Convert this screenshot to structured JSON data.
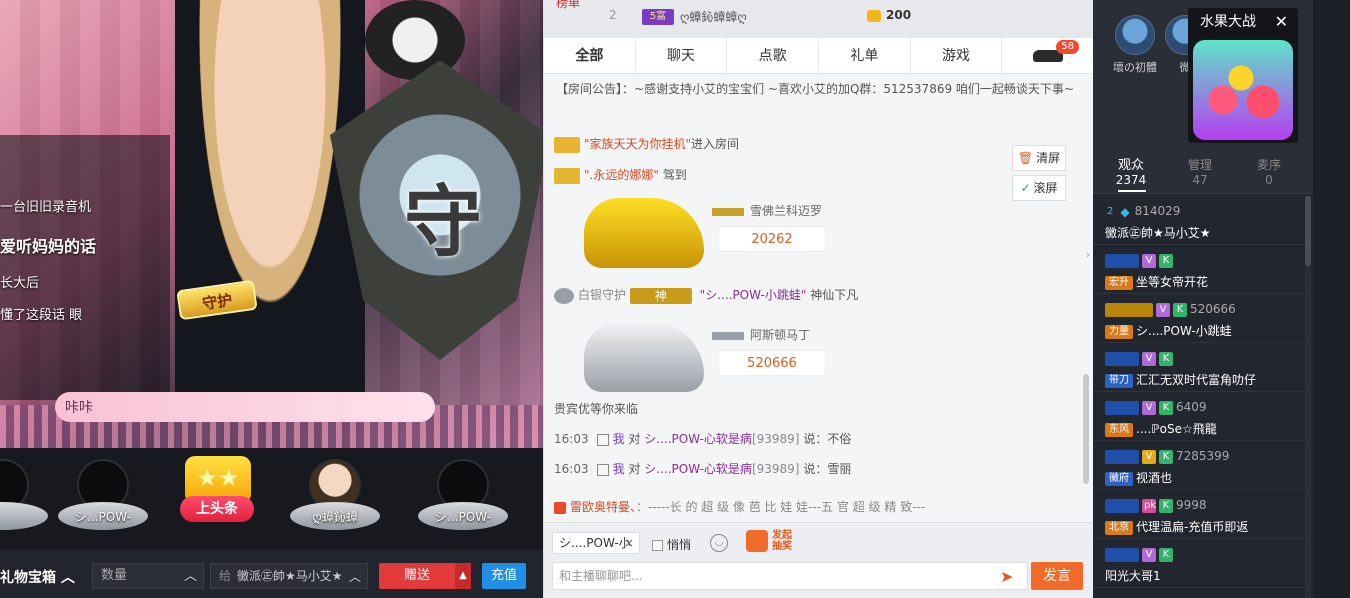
{
  "video": {
    "overlay_lines": [
      "一台旧旧录音机",
      "爱听妈妈的话",
      "长大后",
      "懂了这段话 眼"
    ],
    "shield_char": "守",
    "gold_badge": "守护",
    "nameplate": "咔咔"
  },
  "guards": [
    {
      "name": "シ...POW-",
      "type": "dark"
    },
    {
      "name": "シ...POW-",
      "type": "dark"
    },
    {
      "name": "ღ蟑鈊蟑",
      "type": "light"
    },
    {
      "name": "シ...POW-",
      "type": "dark"
    }
  ],
  "headline": {
    "icon": "★★",
    "label": "上头条"
  },
  "bottombar": {
    "treasure_label": "礼物宝箱",
    "quantity_placeholder": "数量",
    "give_to_label": "给",
    "give_to_value": "黴派㊣帥★马小艾★",
    "send_gift": "赠送",
    "recharge": "充值"
  },
  "chat": {
    "rank": {
      "rank_no": "2",
      "level": "5富",
      "user": "ღ蟑鈊蟑蟑ღ",
      "coins": "200",
      "top_label": "榜单"
    },
    "tabs": [
      {
        "label": "全部",
        "active": true
      },
      {
        "label": "聊天",
        "active": false
      },
      {
        "label": "点歌",
        "active": false
      },
      {
        "label": "礼单",
        "active": false
      },
      {
        "label": "游戏",
        "active": false
      },
      {
        "label": "",
        "count": "58",
        "active": false
      }
    ],
    "announcement_label": "【房间公告】：",
    "announcement_text": "~感谢支持小艾的宝宝们 ~喜欢小艾的加Q群：512537869 咱们一起畅谈天下事~",
    "enter1": {
      "user": "\"家族天天为你挂机\"",
      "action": "进入房间"
    },
    "enter2": {
      "user": "\".永远的娜娜\"",
      "action": "驾到"
    },
    "car1": {
      "brand": "雪佛兰科迈罗",
      "price": "20262"
    },
    "guard_line": {
      "tier": "白银守护",
      "badge": "神",
      "user": "\"シ....POW-小跳蛙\"",
      "action": "神仙下凡"
    },
    "car2": {
      "brand": "阿斯顿马丁",
      "price": "520666"
    },
    "cut_line": "贵宾优等你来临",
    "msgs": [
      {
        "time": "16:03",
        "me": "我",
        "to": "对",
        "target": "シ....POW-心软是病",
        "id": "[93989]",
        "say": "说：不俗"
      },
      {
        "time": "16:03",
        "me": "我",
        "to": "对",
        "target": "シ....POW-心软是病",
        "id": "[93989]",
        "say": "说：雪丽"
      }
    ],
    "system": {
      "name": "雷欧奥特曼、",
      "text": "：-----长 的 超 级 像 芭 比 娃 娃---五 官 超 级 精 致---"
    },
    "tools": {
      "clear": "清屏",
      "scroll": "滚屏"
    },
    "input": {
      "target": "シ....POW-小",
      "whisper": "悄悄",
      "lottery": "发起抽奖",
      "placeholder": "和主播聊聊吧...",
      "send": "发言"
    }
  },
  "right": {
    "top_users": [
      {
        "name": "壞の初體"
      },
      {
        "name": "微"
      }
    ],
    "fruit_game": {
      "title": "水果大战",
      "icon": "fruit-game-icon"
    },
    "tabs": [
      {
        "label": "观众",
        "count": "2374",
        "active": true
      },
      {
        "label": "管理",
        "count": "47",
        "active": false
      },
      {
        "label": "麦序",
        "count": "0",
        "active": false
      }
    ],
    "audience": [
      {
        "badges": [
          "2",
          "diamond"
        ],
        "id": "814029",
        "name": "黴派㊣帥★马小艾★",
        "family": ""
      },
      {
        "badges": [
          "lvl",
          "V",
          "K"
        ],
        "id": "",
        "name": "坐等女帝开花",
        "family": "宏升"
      },
      {
        "badges": [
          "gold",
          "V",
          "K"
        ],
        "id": "520666",
        "name": "シ....POW-小跳蛙",
        "family": "力量"
      },
      {
        "badges": [
          "lvl",
          "V",
          "K"
        ],
        "id": "",
        "name": "汇汇无双时代富角叻仔",
        "family": "带刀"
      },
      {
        "badges": [
          "lvl",
          "V",
          "K"
        ],
        "id": "6409",
        "name": "....ℙoSe☆飛龍",
        "family": "东风"
      },
      {
        "badges": [
          "lvl",
          "V",
          "K"
        ],
        "id": "7285399",
        "name": "视酒也",
        "family": "黴府"
      },
      {
        "badges": [
          "lvl",
          "pk",
          "K"
        ],
        "id": "9998",
        "name": "代理温扁-充值币即返",
        "family": "北京"
      },
      {
        "badges": [
          "lvl",
          "V",
          "K"
        ],
        "id": "",
        "name": "阳光大哥1",
        "family": ""
      }
    ]
  }
}
